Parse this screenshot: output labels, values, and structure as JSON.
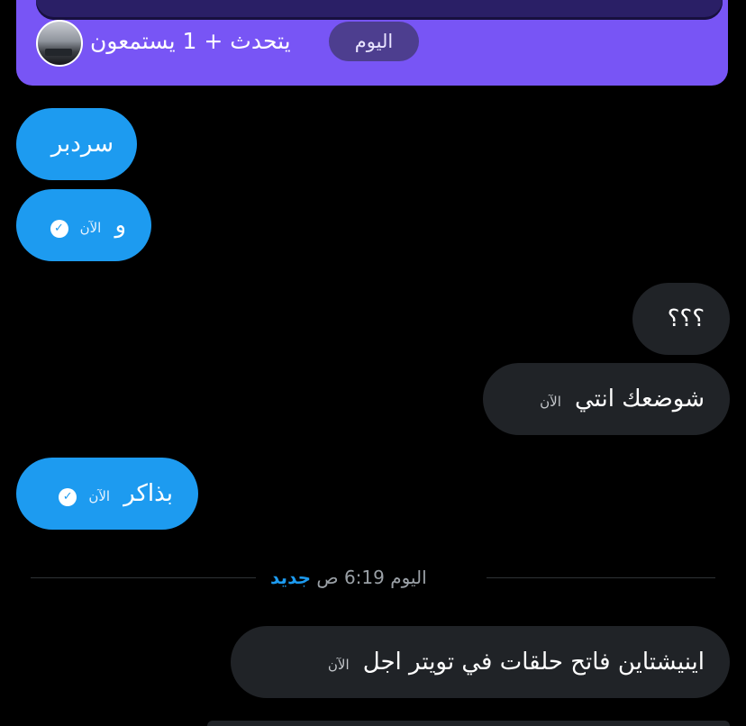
{
  "space": {
    "listeners_text": "يتحدث + 1 يستمعون",
    "day_label": "اليوم",
    "colors": {
      "card": "#7855f5",
      "inner": "#2a1f66",
      "pill": "#4d3e8f"
    }
  },
  "messages": [
    {
      "side": "sent",
      "text": "سردبر",
      "time": ""
    },
    {
      "side": "sent",
      "text": "و",
      "time": "الآن"
    },
    {
      "side": "recv",
      "text": "؟؟؟",
      "time": ""
    },
    {
      "side": "recv",
      "text": "شوضعك انتي",
      "time": "الآن"
    },
    {
      "side": "sent",
      "text": "بذاكر",
      "time": "الآن"
    },
    {
      "side": "recv",
      "text": "اينيشتاين فاتح حلقات في تويتر اجل",
      "time": "الآن"
    }
  ],
  "divider": {
    "day": "اليوم",
    "time": "6:19 ص",
    "new_label": "جديد"
  },
  "icons": {
    "read_receipt": "check-circle-icon",
    "avatar": "avatar-image"
  },
  "colors": {
    "sent_bubble": "#1d9bf0",
    "received_bubble": "#202327",
    "background": "#000000"
  }
}
